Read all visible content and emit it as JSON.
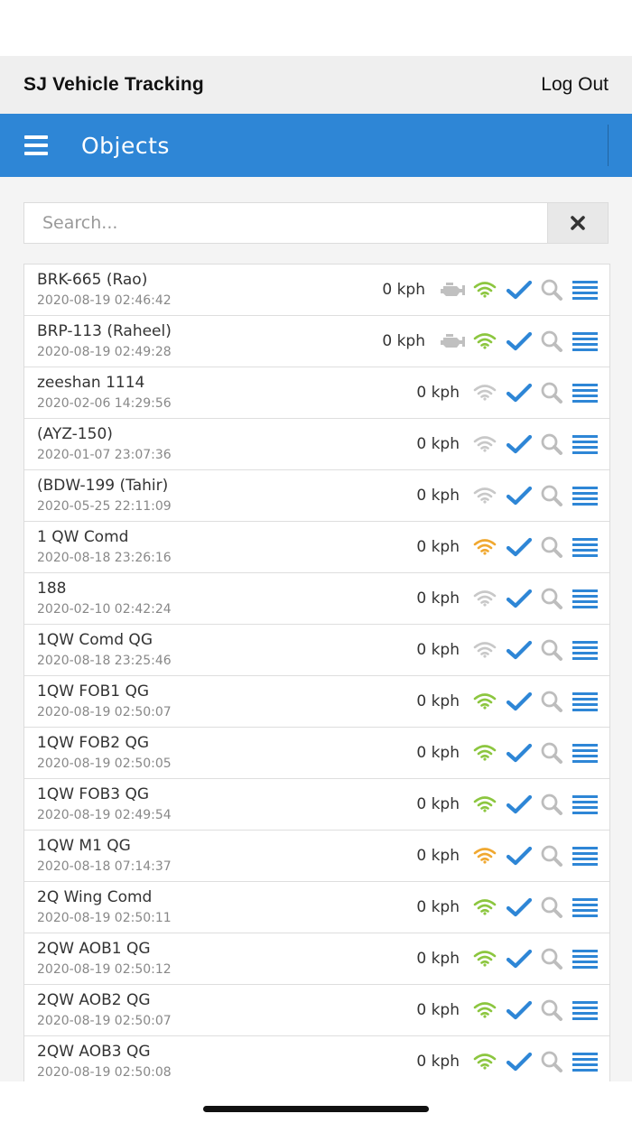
{
  "header": {
    "app_title": "SJ Vehicle Tracking",
    "logout_label": "Log Out"
  },
  "toolbar": {
    "title": "Objects",
    "menu_icon": "hamburger-icon"
  },
  "search": {
    "placeholder": "Search...",
    "value": "",
    "clear_icon": "close-icon"
  },
  "colors": {
    "accent": "#2e86d6",
    "signal_good": "#8cc63f",
    "signal_warn": "#f0a830",
    "signal_off": "#c8c8c8",
    "engine_off": "#c0c0c0",
    "check": "#2e86d6",
    "zoom": "#bdbdbd"
  },
  "objects": [
    {
      "name": "BRK-665 (Rao)",
      "time": "2020-08-19 02:46:42",
      "speed": "0 kph",
      "engine": true,
      "signal": "good"
    },
    {
      "name": "BRP-113 (Raheel)",
      "time": "2020-08-19 02:49:28",
      "speed": "0 kph",
      "engine": true,
      "signal": "good"
    },
    {
      "name": "zeeshan 1114",
      "time": "2020-02-06 14:29:56",
      "speed": "0 kph",
      "engine": false,
      "signal": "off"
    },
    {
      "name": "(AYZ-150)",
      "time": "2020-01-07 23:07:36",
      "speed": "0 kph",
      "engine": false,
      "signal": "off"
    },
    {
      "name": "(BDW-199 (Tahir)",
      "time": "2020-05-25 22:11:09",
      "speed": "0 kph",
      "engine": false,
      "signal": "off"
    },
    {
      "name": "1 QW Comd",
      "time": "2020-08-18 23:26:16",
      "speed": "0 kph",
      "engine": false,
      "signal": "warn"
    },
    {
      "name": "188",
      "time": "2020-02-10 02:42:24",
      "speed": "0 kph",
      "engine": false,
      "signal": "off"
    },
    {
      "name": "1QW Comd QG",
      "time": "2020-08-18 23:25:46",
      "speed": "0 kph",
      "engine": false,
      "signal": "off"
    },
    {
      "name": "1QW FOB1 QG",
      "time": "2020-08-19 02:50:07",
      "speed": "0 kph",
      "engine": false,
      "signal": "good"
    },
    {
      "name": "1QW FOB2 QG",
      "time": "2020-08-19 02:50:05",
      "speed": "0 kph",
      "engine": false,
      "signal": "good"
    },
    {
      "name": "1QW FOB3 QG",
      "time": "2020-08-19 02:49:54",
      "speed": "0 kph",
      "engine": false,
      "signal": "good"
    },
    {
      "name": "1QW M1 QG",
      "time": "2020-08-18 07:14:37",
      "speed": "0 kph",
      "engine": false,
      "signal": "warn"
    },
    {
      "name": "2Q Wing Comd",
      "time": "2020-08-19 02:50:11",
      "speed": "0 kph",
      "engine": false,
      "signal": "good"
    },
    {
      "name": "2QW AOB1 QG",
      "time": "2020-08-19 02:50:12",
      "speed": "0 kph",
      "engine": false,
      "signal": "good"
    },
    {
      "name": "2QW AOB2 QG",
      "time": "2020-08-19 02:50:07",
      "speed": "0 kph",
      "engine": false,
      "signal": "good"
    },
    {
      "name": "2QW AOB3 QG",
      "time": "2020-08-19 02:50:08",
      "speed": "0 kph",
      "engine": false,
      "signal": "good"
    }
  ]
}
